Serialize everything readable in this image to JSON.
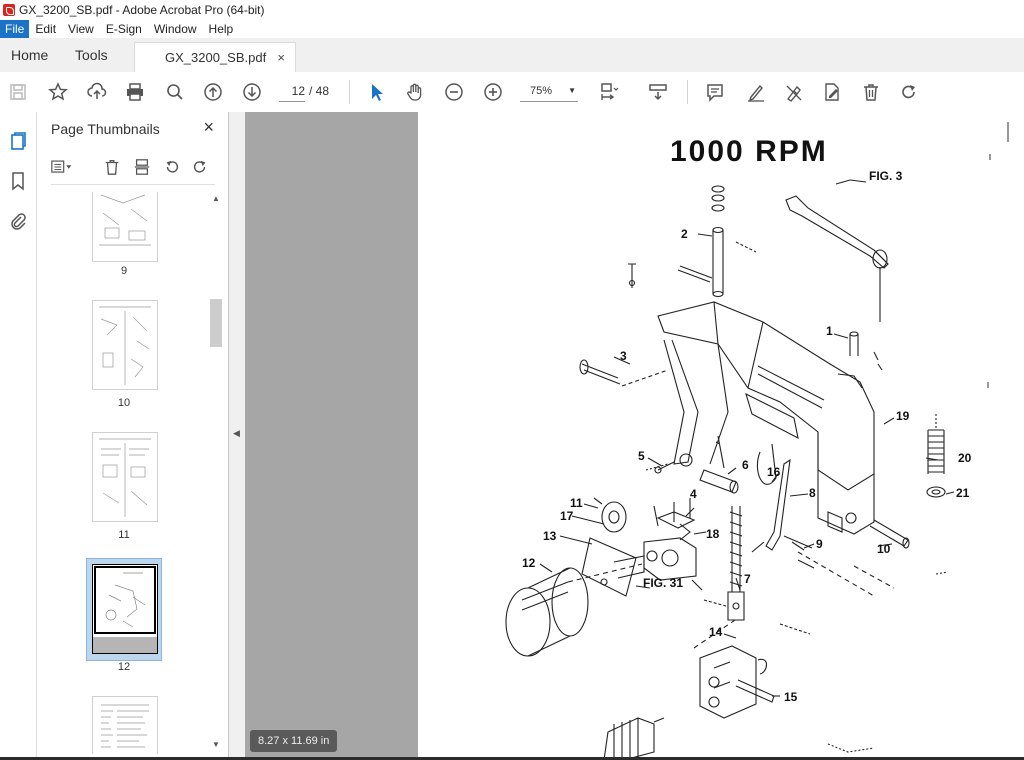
{
  "window": {
    "title": "GX_3200_SB.pdf - Adobe Acrobat Pro (64-bit)"
  },
  "menu": {
    "items": [
      "File",
      "Edit",
      "View",
      "E-Sign",
      "Window",
      "Help"
    ]
  },
  "tabs": {
    "home": "Home",
    "tools": "Tools",
    "document": "GX_3200_SB.pdf",
    "close": "×"
  },
  "toolbar": {
    "page_current": "12",
    "page_total": "/ 48",
    "zoom": "75%"
  },
  "panel": {
    "title": "Page Thumbnails",
    "close": "×",
    "thumbnails": [
      "9",
      "10",
      "11",
      "12"
    ],
    "selected": "12"
  },
  "document": {
    "page_size": "8.27 x 11.69 in",
    "heading": "1000 RPM",
    "labels": {
      "fig3": "FIG. 3",
      "fig31": "FIG. 31",
      "n1": "1",
      "n2": "2",
      "n3": "3",
      "n4": "4",
      "n5": "5",
      "n6": "6",
      "n7": "7",
      "n8": "8",
      "n9": "9",
      "n10": "10",
      "n11": "11",
      "n12": "12",
      "n13": "13",
      "n14": "14",
      "n15": "15",
      "n16": "16",
      "n17": "17",
      "n18": "18",
      "n19": "19",
      "n20": "20",
      "n21": "21"
    }
  },
  "colors": {
    "accent": "#1a73c8",
    "pdf_red": "#d7261e",
    "doc_bg": "#a6a6a6",
    "thumb_sel": "#bcd6ee"
  },
  "icons": [
    "pdf-icon",
    "save-icon",
    "star-icon",
    "cloud-upload-icon",
    "print-icon",
    "search-icon",
    "arrow-up-icon",
    "arrow-down-icon",
    "pointer-icon",
    "hand-icon",
    "zoom-out-icon",
    "zoom-in-icon",
    "fit-page-icon",
    "scroll-mode-icon",
    "comment-icon",
    "highlight-icon",
    "sign-icon",
    "edit-icon",
    "trash-icon",
    "rotate-icon",
    "pages-icon",
    "bookmark-icon",
    "attachment-icon"
  ]
}
